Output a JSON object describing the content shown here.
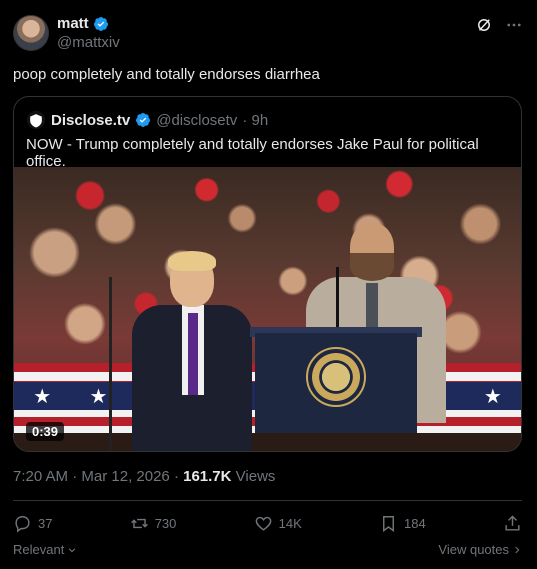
{
  "author": {
    "display_name": "matt",
    "handle": "@mattxiv",
    "verified_color": "#1d9bf0"
  },
  "post": {
    "text": "poop completely and totally endorses diarrhea"
  },
  "quote": {
    "source_name": "Disclose.tv",
    "source_handle": "@disclosetv",
    "age": "· 9h",
    "text": "NOW - Trump completely and totally endorses Jake Paul for political office.",
    "video_duration": "0:39"
  },
  "meta": {
    "time": "7:20 AM",
    "date": "· Mar 12, 2026 ·",
    "views_count": "161.7K",
    "views_label": "Views"
  },
  "actions": {
    "replies": "37",
    "reposts": "730",
    "likes": "14K",
    "bookmarks": "184"
  },
  "footer": {
    "sort_label": "Relevant",
    "view_quotes_label": "View quotes"
  },
  "icons": {
    "grok": "grok-icon",
    "more": "more-icon",
    "reply": "reply-icon",
    "repost": "repost-icon",
    "like": "like-icon",
    "bookmark": "bookmark-icon",
    "share": "share-icon"
  }
}
